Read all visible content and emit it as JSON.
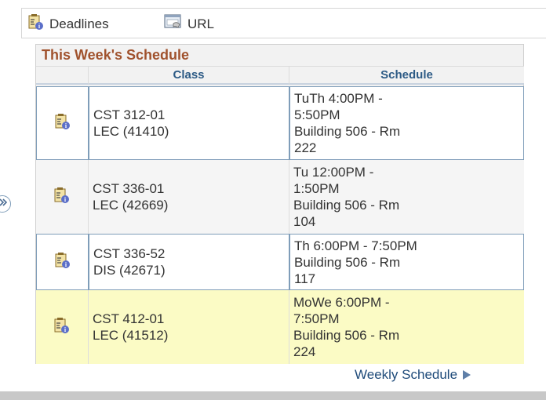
{
  "top_links": [
    {
      "label": "Deadlines",
      "icon": "deadlines-icon"
    },
    {
      "label": "URL",
      "icon": "url-icon"
    }
  ],
  "panel": {
    "title": "This Week's Schedule",
    "columns": [
      "Class",
      "Schedule"
    ],
    "rows": [
      {
        "class_line1": "CST 312-01",
        "class_line2": "LEC (41410)",
        "schedule_lines": [
          "TuTh 4:00PM -",
          "5:50PM",
          "Building 506 - Rm",
          "222"
        ]
      },
      {
        "class_line1": "CST 336-01",
        "class_line2": "LEC (42669)",
        "schedule_lines": [
          "Tu 12:00PM -",
          "1:50PM",
          "Building 506 - Rm",
          "104"
        ]
      },
      {
        "class_line1": "CST 336-52",
        "class_line2": "DIS (42671)",
        "schedule_lines": [
          "Th 6:00PM - 7:50PM",
          "Building 506 - Rm",
          "117"
        ]
      },
      {
        "class_line1": "CST 412-01",
        "class_line2": "LEC (41512)",
        "schedule_lines": [
          "MoWe 6:00PM -",
          "7:50PM",
          "Building 506 - Rm",
          "224"
        ]
      }
    ]
  },
  "footer": {
    "weekly_schedule_label": "Weekly Schedule"
  },
  "colors": {
    "title": "#a0522d",
    "header": "#2c5a85",
    "link": "#1f4b7a",
    "highlight": "#fbfbc5"
  }
}
